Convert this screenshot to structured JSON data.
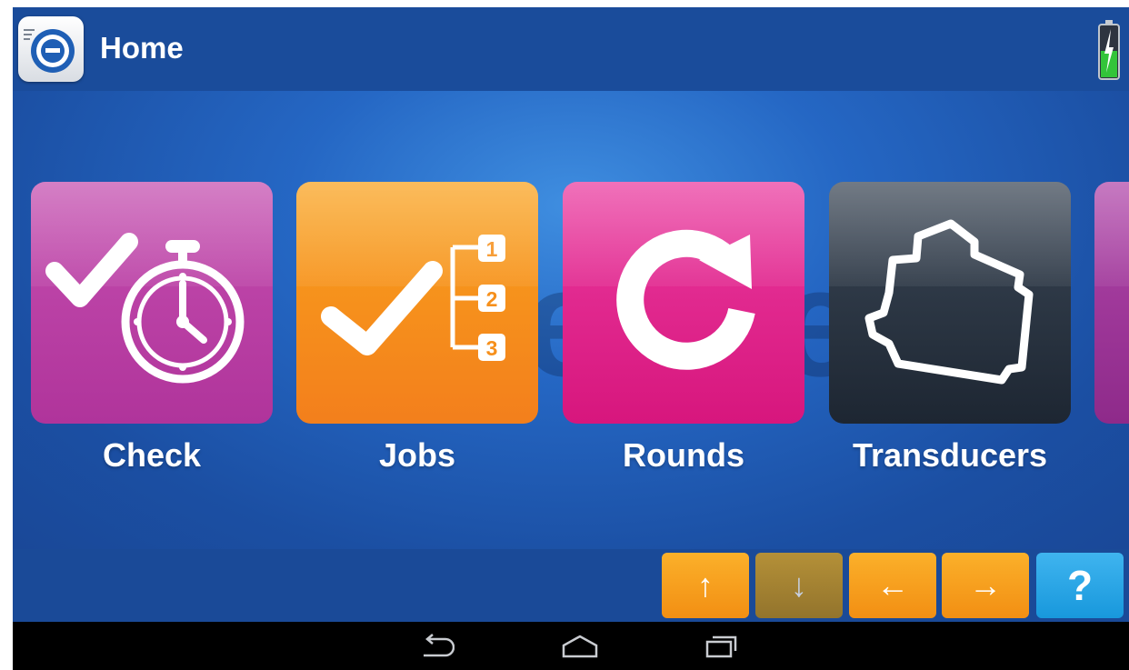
{
  "header": {
    "title": "Home",
    "app_icon": "e-logo-icon",
    "battery_icon": "battery-charging-icon"
  },
  "watermark": "e",
  "tiles": [
    {
      "label": "Check",
      "icon": "check-stopwatch-icon",
      "color": "#b8399f"
    },
    {
      "label": "Jobs",
      "icon": "check-numbered-list-icon",
      "color": "#f6901c"
    },
    {
      "label": "Rounds",
      "icon": "refresh-arrow-icon",
      "color": "#e0248c"
    },
    {
      "label": "Transducers",
      "icon": "transducer-outline-icon",
      "color": "#2a3441"
    }
  ],
  "jobs_list_numbers": [
    "1",
    "2",
    "3"
  ],
  "navigation": {
    "up": "↑",
    "down": "↓",
    "left": "←",
    "right": "→",
    "help": "?"
  },
  "system_bar": [
    "back-icon",
    "home-icon",
    "recent-apps-icon"
  ],
  "colors": {
    "background": "#1d52a3",
    "nav_orange": "#f6a01f",
    "help_blue": "#2aa6e6"
  }
}
